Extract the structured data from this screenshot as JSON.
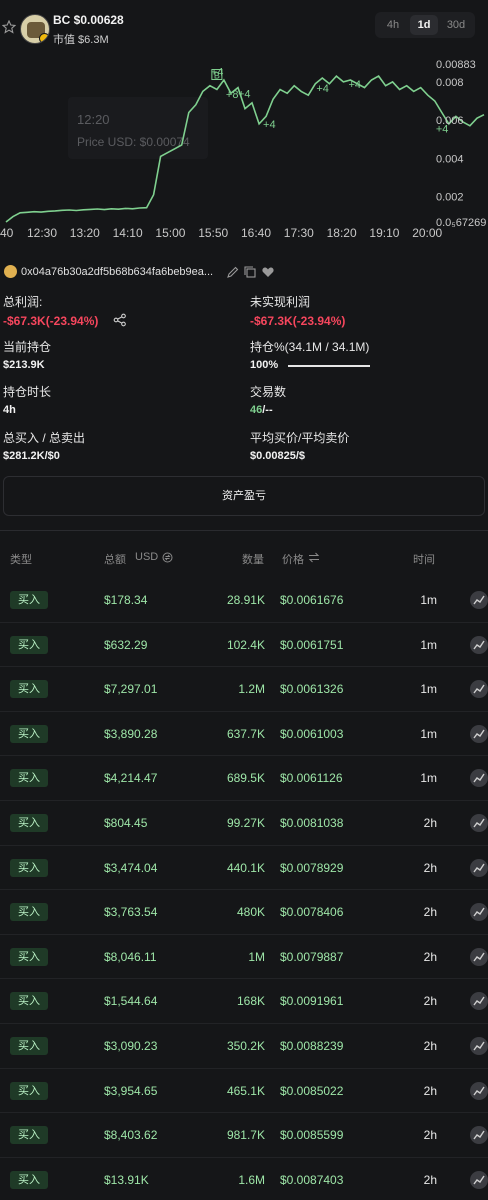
{
  "header": {
    "ticker": "BC $0.00628",
    "market_cap": "市值 $6.3M",
    "timeframes": [
      "4h",
      "1d",
      "30d"
    ],
    "active_timeframe": "1d"
  },
  "chart_data": {
    "type": "line",
    "color": "#7fd08f",
    "x_ticks": [
      "40",
      "12:30",
      "13:20",
      "14:10",
      "15:00",
      "15:50",
      "16:40",
      "17:30",
      "18:20",
      "19:10",
      "20:00"
    ],
    "y_ticks": [
      "0.00883",
      "0.008",
      "0.006",
      "0.004",
      "0.002",
      "0.0₅67269"
    ],
    "tooltip_time": "12:20",
    "tooltip_price": "Price USD: $0.00074",
    "trade_marker_labels": [
      "B",
      "+4",
      "+8",
      "+4",
      "+4",
      "+4",
      "+4",
      "+4"
    ],
    "series": [
      {
        "values": [
          0.00067,
          0.00095,
          0.00115,
          0.00118,
          0.00121,
          0.00119,
          0.00123,
          0.00125,
          0.00128,
          0.0013,
          0.00127,
          0.00131,
          0.00133,
          0.00135,
          0.00132,
          0.00136,
          0.00134,
          0.00138,
          0.00136,
          0.0014,
          0.00142,
          0.0021,
          0.0041,
          0.0043,
          0.0045,
          0.0047,
          0.0064,
          0.0068,
          0.0075,
          0.0078,
          0.0076,
          0.0081,
          0.0074,
          0.0077,
          0.0066,
          0.0069,
          0.0058,
          0.0062,
          0.0071,
          0.0076,
          0.0074,
          0.0078,
          0.0075,
          0.0073,
          0.0079,
          0.0082,
          0.0079,
          0.0083,
          0.008,
          0.0081,
          0.0079,
          0.0077,
          0.0081,
          0.0083,
          0.0078,
          0.008,
          0.0076,
          0.0078,
          0.0075,
          0.0077,
          0.0073,
          0.007,
          0.0064,
          0.0058,
          0.0062,
          0.0059,
          0.0057,
          0.0061,
          0.00628
        ]
      }
    ]
  },
  "wallet": {
    "address": "0x04a76b30a2df5b68b634fa6beb9ea..."
  },
  "stats": {
    "total_profit_label": "总利润:",
    "total_profit_value": "-$67.3K(-23.94%)",
    "unrealized_label": "未实现利润",
    "unrealized_value": "-$67.3K(-23.94%)",
    "holding_label": "当前持仓",
    "holding_value": "$213.9K",
    "position_label": "持仓%(34.1M / 34.1M)",
    "position_value": "100%",
    "position_fill": 1.0,
    "duration_label": "持仓时长",
    "duration_value": "4h",
    "trades_label": "交易数",
    "trades_buys": "46",
    "trades_sells": "/--",
    "buy_sell_label": "总买入 / 总卖出",
    "buy_sell_value": "$281.2K/$0",
    "avg_price_label": "平均买价/平均卖价",
    "avg_price_value": "$0.00825/$"
  },
  "pnl_button": "资产盈亏",
  "table": {
    "headers": {
      "type": "类型",
      "total": "总额",
      "unit": "USD",
      "qty": "数量",
      "price": "价格",
      "time": "时间"
    },
    "rows": [
      {
        "type": "买入",
        "total": "$178.34",
        "qty": "28.91K",
        "price": "$0.0061676",
        "time": "1m"
      },
      {
        "type": "买入",
        "total": "$632.29",
        "qty": "102.4K",
        "price": "$0.0061751",
        "time": "1m"
      },
      {
        "type": "买入",
        "total": "$7,297.01",
        "qty": "1.2M",
        "price": "$0.0061326",
        "time": "1m"
      },
      {
        "type": "买入",
        "total": "$3,890.28",
        "qty": "637.7K",
        "price": "$0.0061003",
        "time": "1m"
      },
      {
        "type": "买入",
        "total": "$4,214.47",
        "qty": "689.5K",
        "price": "$0.0061126",
        "time": "1m"
      },
      {
        "type": "买入",
        "total": "$804.45",
        "qty": "99.27K",
        "price": "$0.0081038",
        "time": "2h"
      },
      {
        "type": "买入",
        "total": "$3,474.04",
        "qty": "440.1K",
        "price": "$0.0078929",
        "time": "2h"
      },
      {
        "type": "买入",
        "total": "$3,763.54",
        "qty": "480K",
        "price": "$0.0078406",
        "time": "2h"
      },
      {
        "type": "买入",
        "total": "$8,046.11",
        "qty": "1M",
        "price": "$0.0079887",
        "time": "2h"
      },
      {
        "type": "买入",
        "total": "$1,544.64",
        "qty": "168K",
        "price": "$0.0091961",
        "time": "2h"
      },
      {
        "type": "买入",
        "total": "$3,090.23",
        "qty": "350.2K",
        "price": "$0.0088239",
        "time": "2h"
      },
      {
        "type": "买入",
        "total": "$3,954.65",
        "qty": "465.1K",
        "price": "$0.0085022",
        "time": "2h"
      },
      {
        "type": "买入",
        "total": "$8,403.62",
        "qty": "981.7K",
        "price": "$0.0085599",
        "time": "2h"
      },
      {
        "type": "买入",
        "total": "$13.91K",
        "qty": "1.6M",
        "price": "$0.0087403",
        "time": "2h"
      }
    ]
  }
}
